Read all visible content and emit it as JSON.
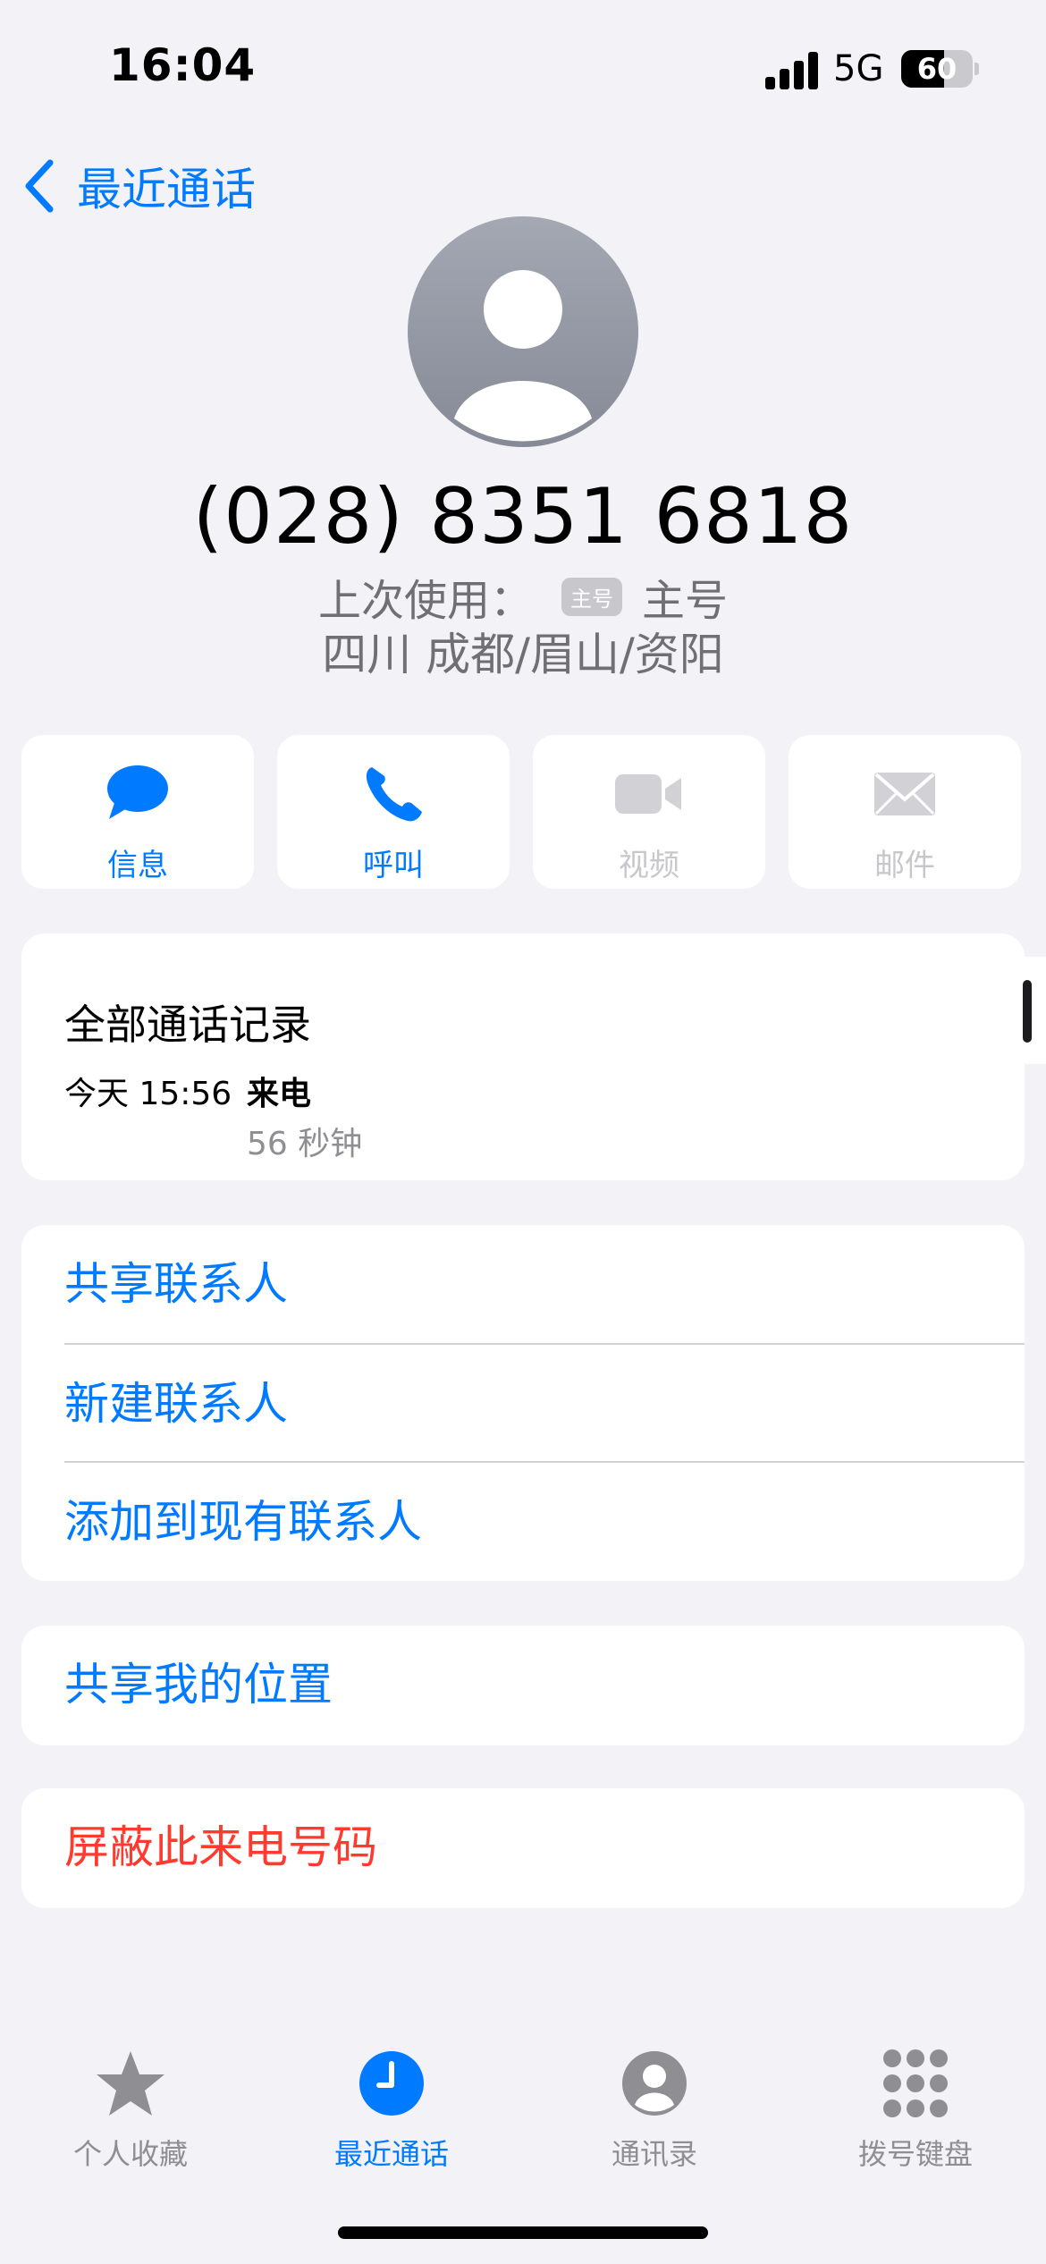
{
  "status_bar": {
    "time": "16:04",
    "network": "5G",
    "battery": "60",
    "battery_level": 0.6
  },
  "nav": {
    "back_label": "最近通话"
  },
  "contact": {
    "phone": "(028) 8351 6818",
    "last_used_label": "上次使用：",
    "line_badge": "主号",
    "line_name": "主号",
    "location": "四川 成都/眉山/资阳"
  },
  "actions": [
    {
      "label": "信息",
      "icon": "message-bubble-icon",
      "enabled": true
    },
    {
      "label": "呼叫",
      "icon": "phone-icon",
      "enabled": true
    },
    {
      "label": "视频",
      "icon": "video-camera-icon",
      "enabled": false
    },
    {
      "label": "邮件",
      "icon": "envelope-icon",
      "enabled": false
    }
  ],
  "call_history": {
    "title": "全部通话记录",
    "entries": [
      {
        "date": "今天 15:56",
        "type": "来电",
        "duration": "56 秒钟"
      }
    ]
  },
  "contact_actions": [
    "共享联系人",
    "新建联系人",
    "添加到现有联系人"
  ],
  "share_location": "共享我的位置",
  "block": "屏蔽此来电号码",
  "tabbar": [
    {
      "label": "个人收藏",
      "icon": "star-icon",
      "active": false
    },
    {
      "label": "最近通话",
      "icon": "clock-icon",
      "active": true
    },
    {
      "label": "通讯录",
      "icon": "person-circle-icon",
      "active": false
    },
    {
      "label": "拨号键盘",
      "icon": "keypad-icon",
      "active": false
    }
  ],
  "colors": {
    "accent": "#007aff",
    "destructive": "#ff3b30",
    "background": "#f2f2f7",
    "disabled": "#c7c7cc"
  }
}
